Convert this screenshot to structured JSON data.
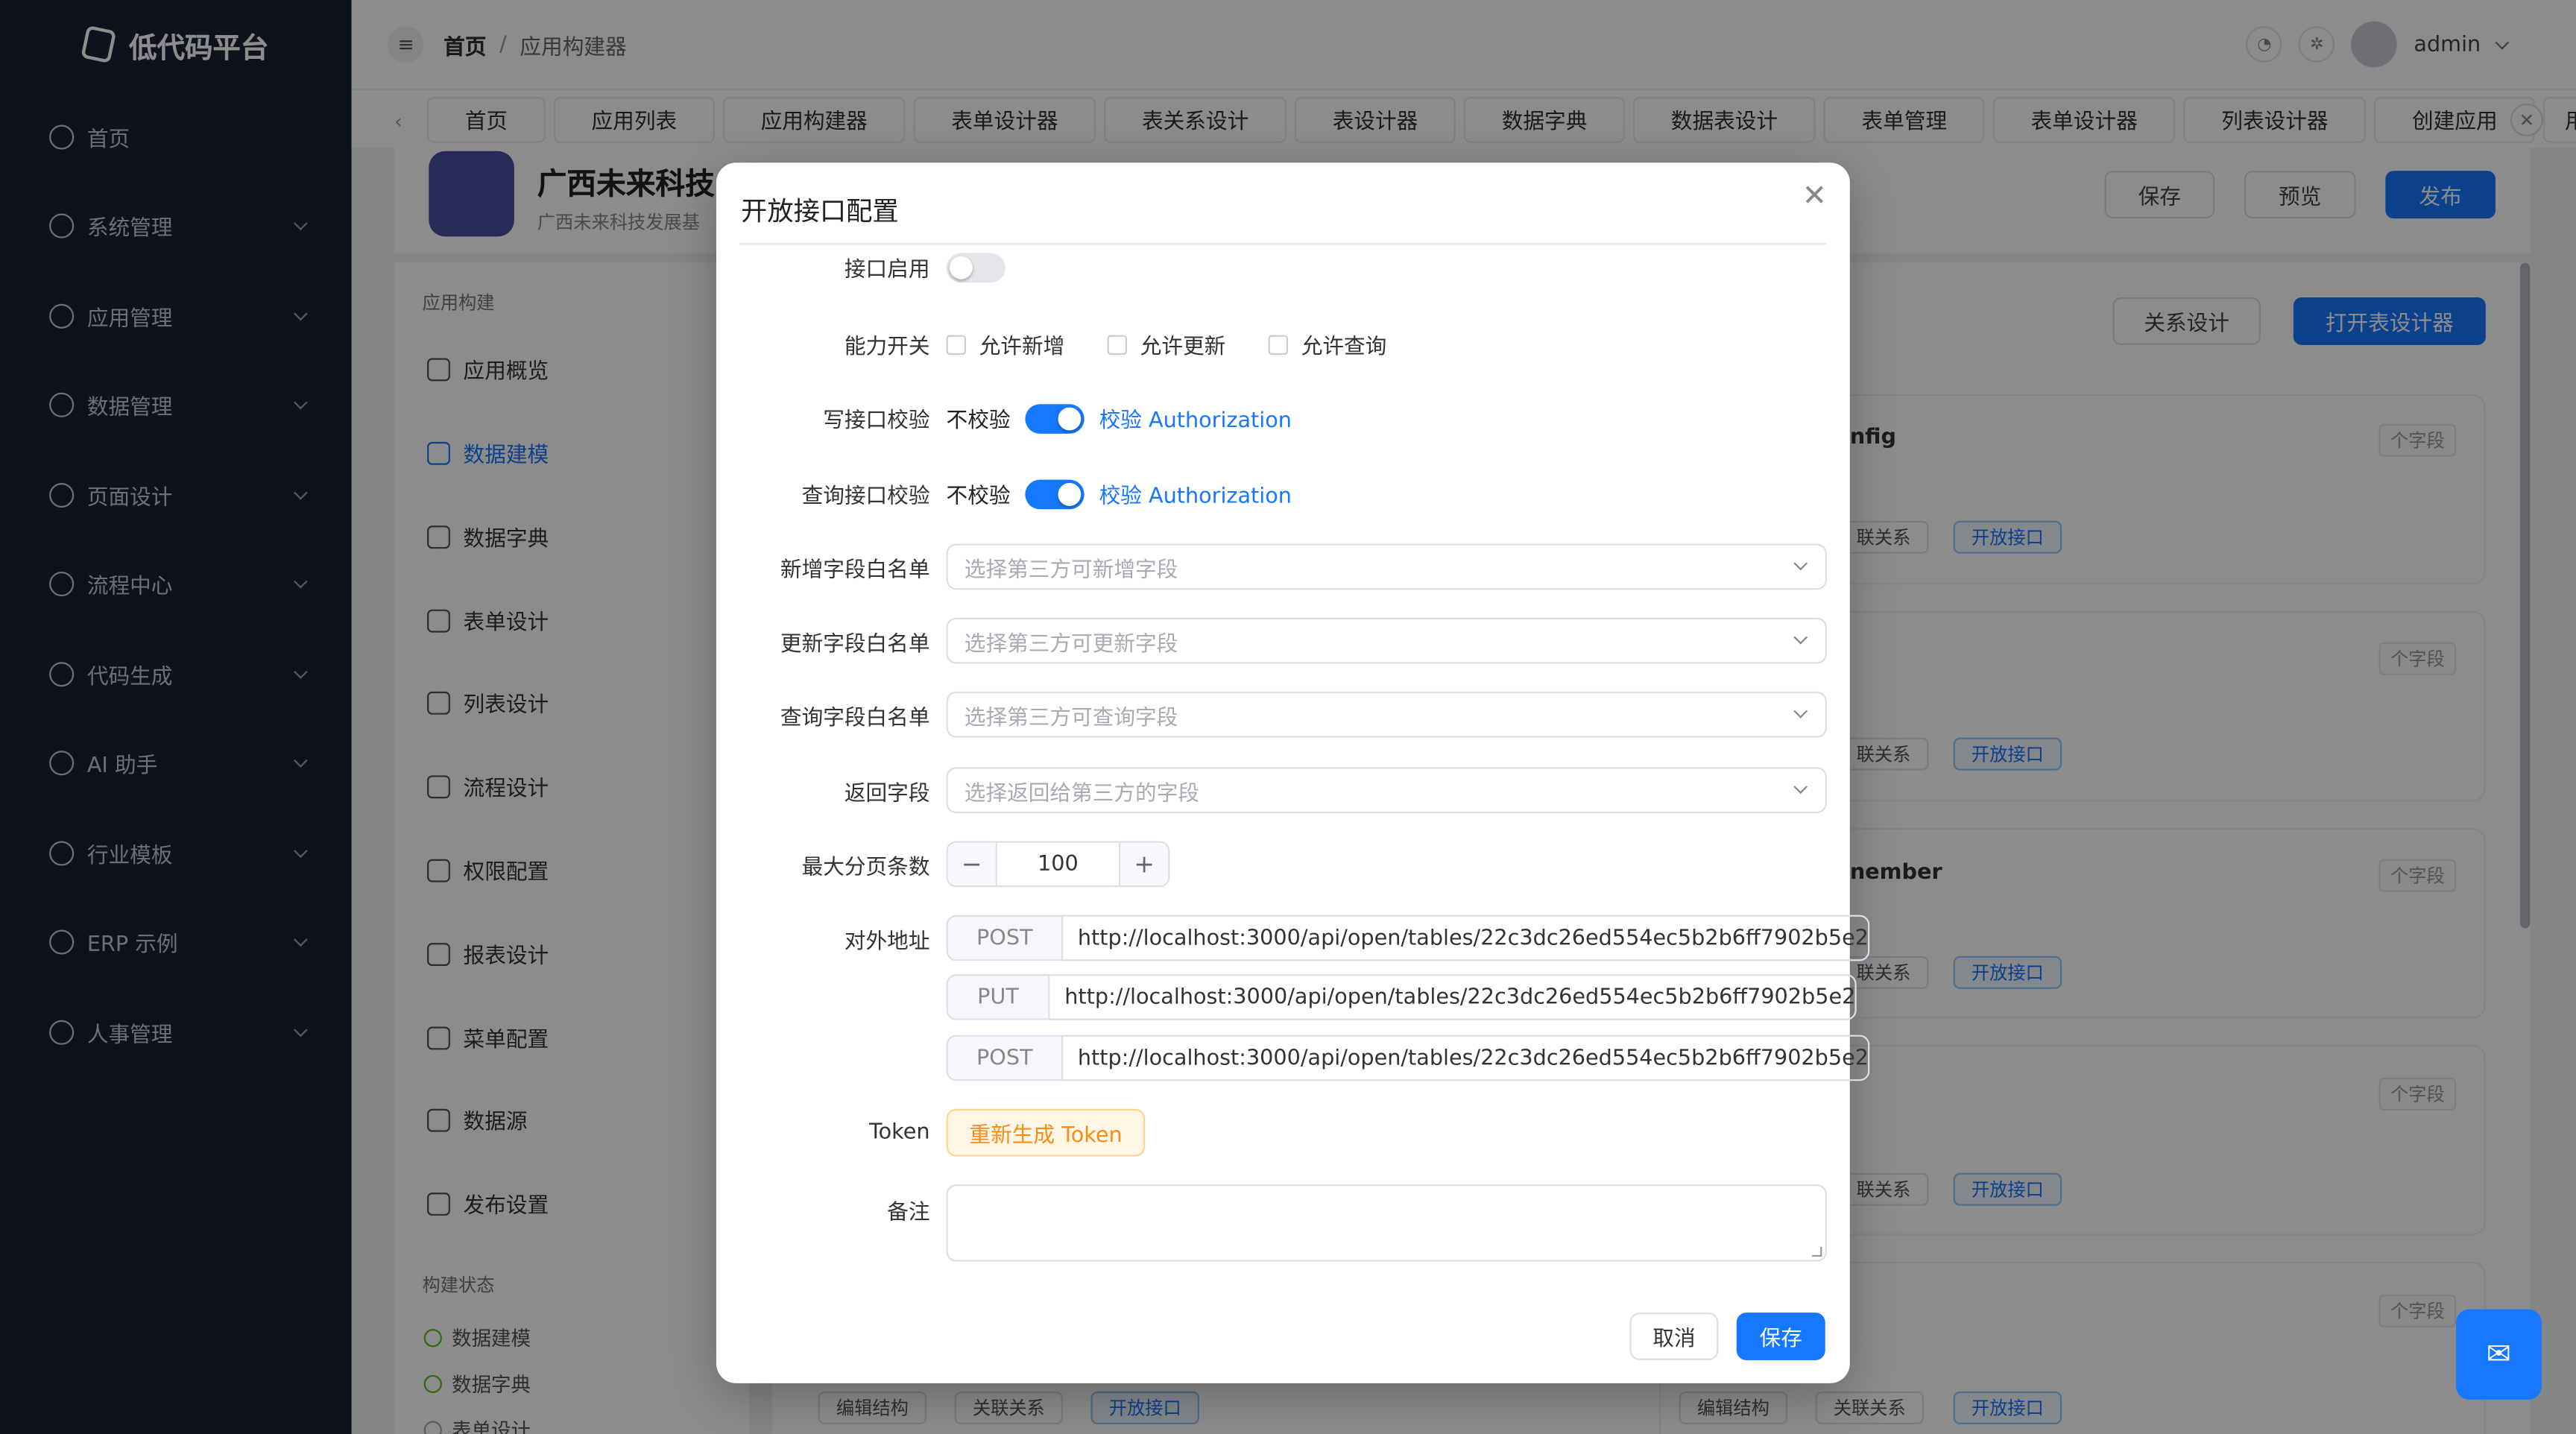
{
  "brand": {
    "name": "低代码平台"
  },
  "sidebar": {
    "items": [
      {
        "label": "首页",
        "icon": "dashboard-icon",
        "expandable": false
      },
      {
        "label": "系统管理",
        "icon": "gear-icon",
        "expandable": true
      },
      {
        "label": "应用管理",
        "icon": "document-icon",
        "expandable": true
      },
      {
        "label": "数据管理",
        "icon": "chart-icon",
        "expandable": true
      },
      {
        "label": "页面设计",
        "icon": "loading-icon",
        "expandable": true
      },
      {
        "label": "流程中心",
        "icon": "flow-icon",
        "expandable": true
      },
      {
        "label": "代码生成",
        "icon": "download-icon",
        "expandable": true
      },
      {
        "label": "AI 助手",
        "icon": "chat-icon",
        "expandable": true
      },
      {
        "label": "行业模板",
        "icon": "grid-icon",
        "expandable": true
      },
      {
        "label": "ERP 示例",
        "icon": "building-icon",
        "expandable": true
      },
      {
        "label": "人事管理",
        "icon": "user-icon",
        "expandable": true
      }
    ]
  },
  "topbar": {
    "breadcrumb_home": "首页",
    "breadcrumb_sep": "/",
    "breadcrumb_current": "应用构建器",
    "user_name": "admin"
  },
  "tabs": [
    "首页",
    "应用列表",
    "应用构建器",
    "表单设计器",
    "表关系设计",
    "表设计器",
    "数据字典",
    "数据表设计",
    "表单管理",
    "表单设计器",
    "列表设计器",
    "创建应用",
    "用户"
  ],
  "app": {
    "title": "广西未来科技",
    "subtitle": "广西未来科技发展基",
    "save_label": "保存",
    "preview_label": "预览",
    "publish_label": "发布",
    "relation_label": "关系设计",
    "open_designer_label": "打开表设计器"
  },
  "leftnav": {
    "group_label": "应用构建",
    "items": [
      "应用概览",
      "数据建模",
      "数据字典",
      "表单设计",
      "列表设计",
      "流程设计",
      "权限配置",
      "报表设计",
      "菜单配置",
      "数据源",
      "发布设置"
    ],
    "status_label": "构建状态",
    "status_items": [
      "数据建模",
      "数据字典",
      "表单设计"
    ]
  },
  "cards": {
    "field_badge": "个字段",
    "names": [
      "nfig",
      "",
      "nember",
      "",
      ""
    ],
    "tag_edit": "编辑结构",
    "tag_relation": "关联关系",
    "tag_relation_short": "联关系",
    "tag_open": "开放接口"
  },
  "modal": {
    "title": "开放接口配置",
    "enable_label": "接口启用",
    "ability_label": "能力开关",
    "ability_options": [
      "允许新增",
      "允许更新",
      "允许查询"
    ],
    "write_check_label": "写接口校验",
    "query_check_label": "查询接口校验",
    "check_off_text": "不校验",
    "check_on_text": "校验 Authorization",
    "add_whitelist_label": "新增字段白名单",
    "add_whitelist_placeholder": "选择第三方可新增字段",
    "update_whitelist_label": "更新字段白名单",
    "update_whitelist_placeholder": "选择第三方可更新字段",
    "query_whitelist_label": "查询字段白名单",
    "query_whitelist_placeholder": "选择第三方可查询字段",
    "return_fields_label": "返回字段",
    "return_fields_placeholder": "选择返回给第三方的字段",
    "max_page_label": "最大分页条数",
    "max_page_value": "100",
    "address_label": "对外地址",
    "endpoints": [
      {
        "method": "POST",
        "url": "http://localhost:3000/api/open/tables/22c3dc26ed554ec5b2b6ff7902b5e2"
      },
      {
        "method": "PUT",
        "url": "http://localhost:3000/api/open/tables/22c3dc26ed554ec5b2b6ff7902b5e2"
      },
      {
        "method": "POST",
        "url": "http://localhost:3000/api/open/tables/22c3dc26ed554ec5b2b6ff7902b5e2"
      }
    ],
    "token_label": "Token",
    "token_button": "重新生成 Token",
    "remark_label": "备注",
    "cancel_label": "取消",
    "save_label": "保存",
    "enable_on": false,
    "write_check_on": true,
    "query_check_on": true
  },
  "colors": {
    "primary": "#1677ff",
    "sidebar_bg": "#1a2233",
    "token_orange": "#fa8c16"
  }
}
